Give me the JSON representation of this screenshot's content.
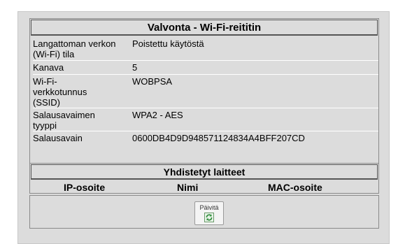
{
  "panel": {
    "title": "Valvonta - Wi-Fi-reititin",
    "rows": [
      {
        "label": "Langattoman verkon (Wi-Fi) tila",
        "value": "Poistettu käytöstä"
      },
      {
        "label": "Kanava",
        "value": "5"
      },
      {
        "label": "Wi-Fi-verkkotunnus (SSID)",
        "value": "WOBPSA"
      },
      {
        "label": "Salausavaimen tyyppi",
        "value": "WPA2 - AES"
      },
      {
        "label": "Salausavain",
        "value": "0600DB4D9D948571124834A4BFF207CD"
      }
    ]
  },
  "devices": {
    "title": "Yhdistetyt laitteet",
    "columns": [
      "IP-osoite",
      "Nimi",
      "MAC-osoite"
    ]
  },
  "refresh": {
    "label": "Päivitä",
    "icon": "refresh-icon",
    "icon_color": "#2e8b3a"
  }
}
